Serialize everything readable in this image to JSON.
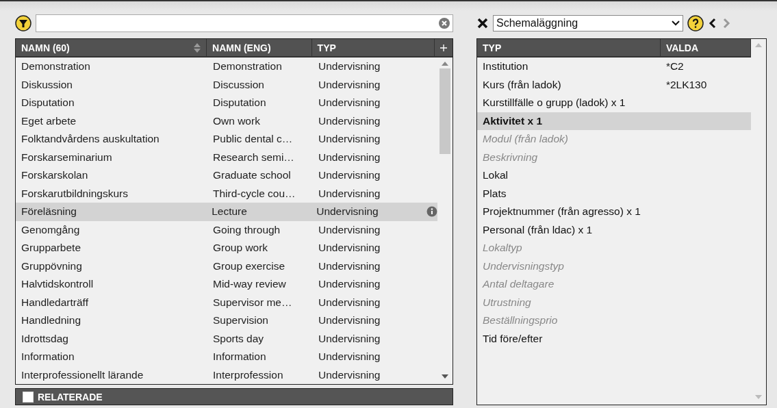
{
  "left_table": {
    "columns": [
      "NAMN (60)",
      "NAMN (ENG)",
      "TYP"
    ],
    "rows": [
      {
        "name": "Demonstration",
        "name_eng": "Demonstration",
        "type": "Undervisning",
        "selected": false
      },
      {
        "name": "Diskussion",
        "name_eng": "Discussion",
        "type": "Undervisning",
        "selected": false
      },
      {
        "name": "Disputation",
        "name_eng": "Disputation",
        "type": "Undervisning",
        "selected": false
      },
      {
        "name": "Eget arbete",
        "name_eng": "Own work",
        "type": "Undervisning",
        "selected": false
      },
      {
        "name": "Folktandvårdens auskultation",
        "name_eng": "Public dental c…",
        "type": "Undervisning",
        "selected": false
      },
      {
        "name": "Forskarseminarium",
        "name_eng": "Research semi…",
        "type": "Undervisning",
        "selected": false
      },
      {
        "name": "Forskarskolan",
        "name_eng": "Graduate school",
        "type": "Undervisning",
        "selected": false
      },
      {
        "name": "Forskarutbildningskurs",
        "name_eng": "Third-cycle cou…",
        "type": "Undervisning",
        "selected": false
      },
      {
        "name": "Föreläsning",
        "name_eng": "Lecture",
        "type": "Undervisning",
        "selected": true
      },
      {
        "name": "Genomgång",
        "name_eng": "Going through",
        "type": "Undervisning",
        "selected": false
      },
      {
        "name": "Grupparbete",
        "name_eng": "Group work",
        "type": "Undervisning",
        "selected": false
      },
      {
        "name": "Gruppövning",
        "name_eng": "Group exercise",
        "type": "Undervisning",
        "selected": false
      },
      {
        "name": "Halvtidskontroll",
        "name_eng": "Mid-way review",
        "type": "Undervisning",
        "selected": false
      },
      {
        "name": "Handledarträff",
        "name_eng": "Supervisor me…",
        "type": "Undervisning",
        "selected": false
      },
      {
        "name": "Handledning",
        "name_eng": "Supervision",
        "type": "Undervisning",
        "selected": false
      },
      {
        "name": "Idrottsdag",
        "name_eng": "Sports day",
        "type": "Undervisning",
        "selected": false
      },
      {
        "name": "Information",
        "name_eng": "Information",
        "type": "Undervisning",
        "selected": false
      },
      {
        "name": "Interprofessionellt lärande",
        "name_eng": "Interprofession",
        "type": "Undervisning",
        "selected": false
      }
    ]
  },
  "related": {
    "label": "RELATERADE",
    "checked": false
  },
  "right_toolbar": {
    "select_value": "Schemaläggning"
  },
  "right_table": {
    "columns": [
      "TYP",
      "VALDA"
    ],
    "rows": [
      {
        "type": "Institution",
        "chosen": "*C2",
        "kind": "normal",
        "selected": false
      },
      {
        "type": "Kurs (från ladok)",
        "chosen": "*2LK130",
        "kind": "normal",
        "selected": false
      },
      {
        "type": "Kurstillfälle o grupp (ladok) x 1",
        "kind": "normal",
        "selected": false
      },
      {
        "type": "Aktivitet x 1",
        "kind": "bold",
        "selected": true
      },
      {
        "type": "Modul (från ladok)",
        "kind": "muted",
        "selected": false
      },
      {
        "type": "Beskrivning",
        "kind": "muted",
        "selected": false
      },
      {
        "type": "Lokal",
        "kind": "normal",
        "selected": false
      },
      {
        "type": "Plats",
        "kind": "normal",
        "selected": false
      },
      {
        "type": "Projektnummer (från agresso) x 1",
        "kind": "normal",
        "selected": false
      },
      {
        "type": "Personal (från ldac) x 1",
        "kind": "normal",
        "selected": false
      },
      {
        "type": "Lokaltyp",
        "kind": "muted",
        "selected": false
      },
      {
        "type": "Undervisningstyp",
        "kind": "muted",
        "selected": false
      },
      {
        "type": "Antal deltagare",
        "kind": "muted",
        "selected": false
      },
      {
        "type": "Utrustning",
        "kind": "muted",
        "selected": false
      },
      {
        "type": "Beställningsprio",
        "kind": "muted",
        "selected": false
      },
      {
        "type": "Tid före/efter",
        "kind": "normal",
        "selected": false
      }
    ]
  }
}
